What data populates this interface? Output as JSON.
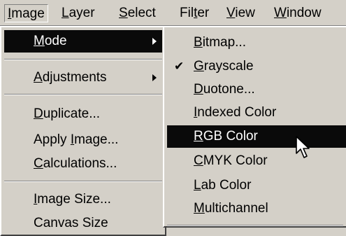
{
  "menubar": {
    "items": [
      {
        "label": "Image",
        "mnemonic": "I",
        "rest": "mage"
      },
      {
        "label": "Layer",
        "mnemonic": "L",
        "rest": "ayer"
      },
      {
        "label": "Select",
        "mnemonic": "S",
        "rest": "elect"
      },
      {
        "label": "Filter",
        "pre": "Fil",
        "mnemonic": "t",
        "rest": "er"
      },
      {
        "label": "View",
        "mnemonic": "V",
        "rest": "iew"
      },
      {
        "label": "Window",
        "mnemonic": "W",
        "rest": "indow"
      }
    ]
  },
  "image_menu": {
    "items": [
      {
        "label": "Mode",
        "mnemonic": "M",
        "rest": "ode",
        "submenu": true,
        "highlighted": true
      },
      {
        "label": "Adjustments",
        "mnemonic": "A",
        "rest": "djustments",
        "submenu": true
      },
      {
        "label": "Duplicate...",
        "mnemonic": "D",
        "rest": "uplicate..."
      },
      {
        "label": "Apply Image...",
        "pre": "Apply ",
        "mnemonic": "I",
        "rest": "mage..."
      },
      {
        "label": "Calculations...",
        "mnemonic": "C",
        "rest": "alculations..."
      },
      {
        "label": "Image Size...",
        "mnemonic": "I",
        "rest": "mage Size..."
      },
      {
        "label": "Canvas Size...",
        "text": "Canvas Size"
      }
    ]
  },
  "mode_submenu": {
    "items": [
      {
        "label": "Bitmap...",
        "mnemonic": "B",
        "rest": "itmap..."
      },
      {
        "label": "Grayscale",
        "mnemonic": "G",
        "rest": "rayscale",
        "checked": true,
        "check_glyph": "✔"
      },
      {
        "label": "Duotone...",
        "mnemonic": "D",
        "rest": "uotone..."
      },
      {
        "label": "Indexed Color",
        "mnemonic": "I",
        "rest": "ndexed Color"
      },
      {
        "label": "RGB Color",
        "mnemonic": "R",
        "rest": "GB Color",
        "highlighted": true
      },
      {
        "label": "CMYK Color",
        "mnemonic": "C",
        "rest": "MYK Color"
      },
      {
        "label": "Lab Color",
        "mnemonic": "L",
        "rest": "ab Color"
      },
      {
        "label": "Multichannel",
        "mnemonic": "M",
        "rest": "ultichannel"
      }
    ]
  },
  "colors": {
    "menu_bg": "#d4d0c8",
    "highlight_bg": "#0a0a0a",
    "highlight_fg": "#ffffff"
  },
  "cursor": {
    "icon": "arrow-pointer-icon"
  }
}
